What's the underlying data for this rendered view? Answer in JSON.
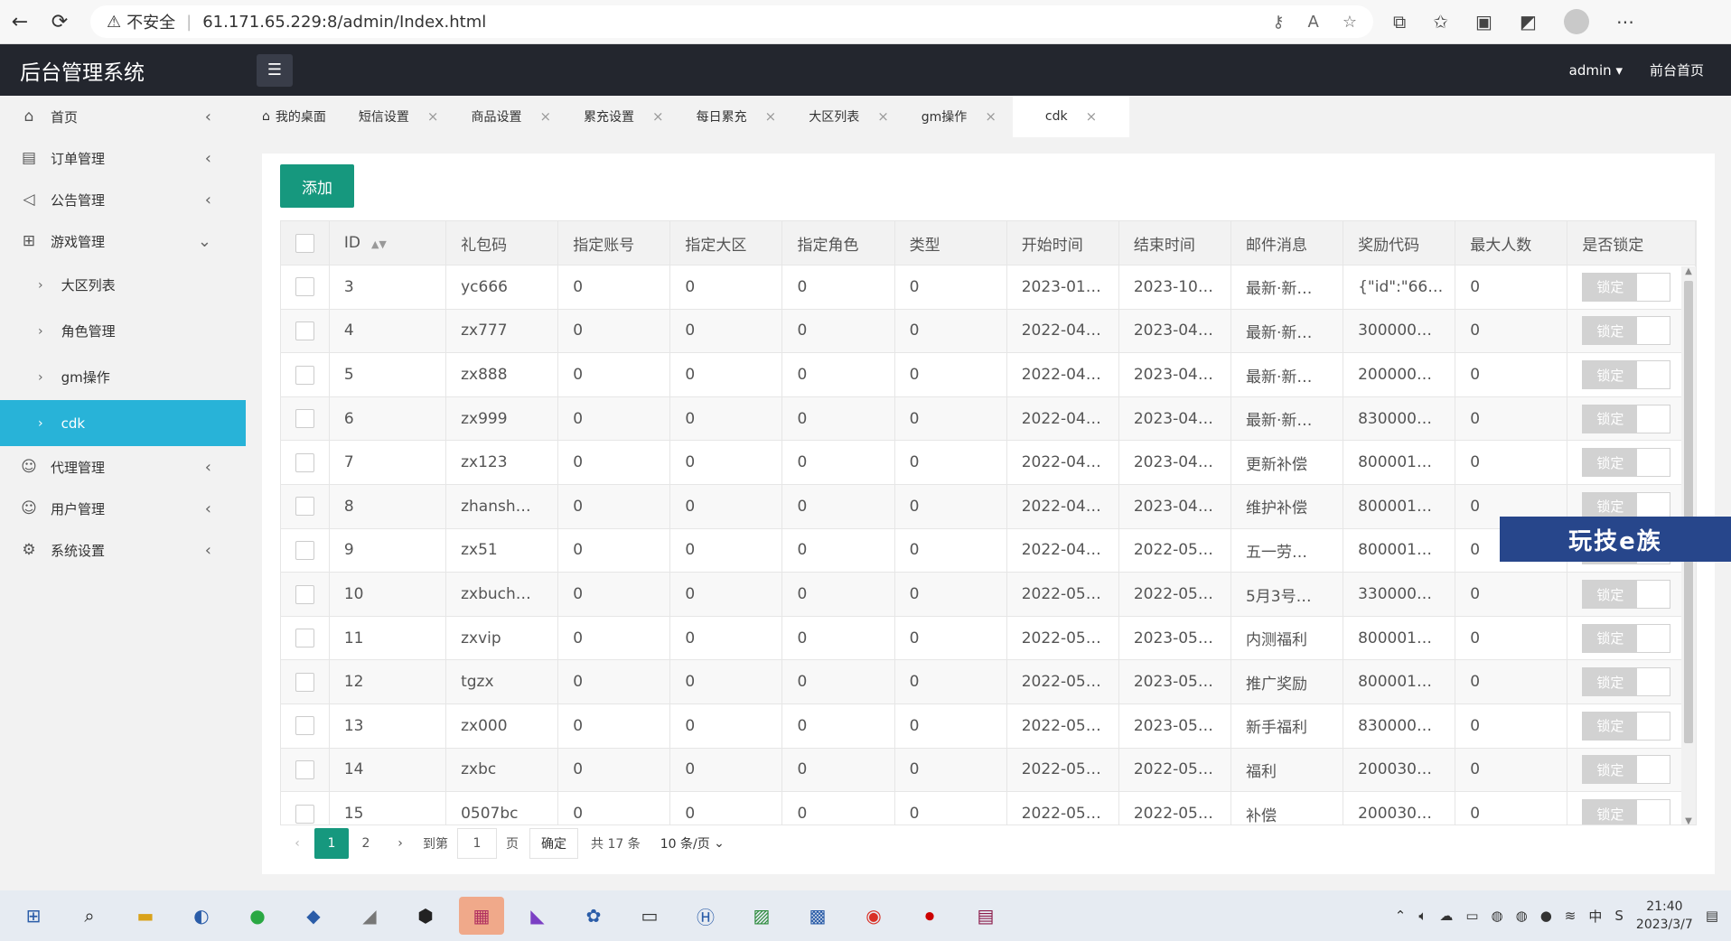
{
  "browser": {
    "security": "不安全",
    "url": "61.171.65.229:8/admin/Index.html"
  },
  "header": {
    "title": "后台管理系统",
    "user": "admin",
    "front_link": "前台首页"
  },
  "sidebar": {
    "items": [
      {
        "label": "首页",
        "icon": "home-icon"
      },
      {
        "label": "订单管理",
        "icon": "document-icon"
      },
      {
        "label": "公告管理",
        "icon": "speaker-icon"
      },
      {
        "label": "游戏管理",
        "icon": "hierarchy-icon"
      }
    ],
    "sub_items": [
      {
        "label": "大区列表"
      },
      {
        "label": "角色管理"
      },
      {
        "label": "gm操作"
      },
      {
        "label": "cdk"
      }
    ],
    "items_after": [
      {
        "label": "代理管理",
        "icon": "user-icon"
      },
      {
        "label": "用户管理",
        "icon": "user-icon"
      },
      {
        "label": "系统设置",
        "icon": "gear-icon"
      }
    ]
  },
  "tabs": [
    {
      "label": "我的桌面"
    },
    {
      "label": "短信设置"
    },
    {
      "label": "商品设置"
    },
    {
      "label": "累充设置"
    },
    {
      "label": "每日累充"
    },
    {
      "label": "大区列表"
    },
    {
      "label": "gm操作"
    },
    {
      "label": "cdk"
    }
  ],
  "toolbar": {
    "add_label": "添加"
  },
  "table": {
    "columns": [
      "ID",
      "礼包码",
      "指定账号",
      "指定大区",
      "指定角色",
      "类型",
      "开始时间",
      "结束时间",
      "邮件消息",
      "奖励代码",
      "最大人数",
      "是否锁定"
    ],
    "lock_label": "锁定",
    "rows": [
      [
        "3",
        "yc666",
        "0",
        "0",
        "0",
        "0",
        "2023-01…",
        "2023-10…",
        "最新·新…",
        "{\"id\":\"66…",
        "0"
      ],
      [
        "4",
        "zx777",
        "0",
        "0",
        "0",
        "0",
        "2022-04…",
        "2023-04…",
        "最新·新…",
        "300000…",
        "0"
      ],
      [
        "5",
        "zx888",
        "0",
        "0",
        "0",
        "0",
        "2022-04…",
        "2023-04…",
        "最新·新…",
        "200000…",
        "0"
      ],
      [
        "6",
        "zx999",
        "0",
        "0",
        "0",
        "0",
        "2022-04…",
        "2023-04…",
        "最新·新…",
        "830000…",
        "0"
      ],
      [
        "7",
        "zx123",
        "0",
        "0",
        "0",
        "0",
        "2022-04…",
        "2023-04…",
        "更新补偿",
        "800001…",
        "0"
      ],
      [
        "8",
        "zhansh…",
        "0",
        "0",
        "0",
        "0",
        "2022-04…",
        "2023-04…",
        "维护补偿",
        "800001…",
        "0"
      ],
      [
        "9",
        "zx51",
        "0",
        "0",
        "0",
        "0",
        "2022-04…",
        "2022-05…",
        "五一劳…",
        "800001…",
        "0"
      ],
      [
        "10",
        "zxbuch…",
        "0",
        "0",
        "0",
        "0",
        "2022-05…",
        "2022-05…",
        "5月3号…",
        "330000…",
        "0"
      ],
      [
        "11",
        "zxvip",
        "0",
        "0",
        "0",
        "0",
        "2022-05…",
        "2023-05…",
        "内测福利",
        "800001…",
        "0"
      ],
      [
        "12",
        "tgzx",
        "0",
        "0",
        "0",
        "0",
        "2022-05…",
        "2023-05…",
        "推广奖励",
        "800001…",
        "0"
      ],
      [
        "13",
        "zx000",
        "0",
        "0",
        "0",
        "0",
        "2022-05…",
        "2023-05…",
        "新手福利",
        "830000…",
        "0"
      ],
      [
        "14",
        "zxbc",
        "0",
        "0",
        "0",
        "0",
        "2022-05…",
        "2022-05…",
        "福利",
        "200030…",
        "0"
      ],
      [
        "15",
        "0507bc",
        "0",
        "0",
        "0",
        "0",
        "2022-05…",
        "2022-05…",
        "补偿",
        "200030…",
        "0"
      ]
    ]
  },
  "pager": {
    "pages": [
      "1",
      "2"
    ],
    "goto_label": "到第",
    "goto_value": "1",
    "page_unit": "页",
    "confirm": "确定",
    "total": "共 17 条",
    "per_page": "10 条/页"
  },
  "watermark": "玩技e族",
  "taskbar": {
    "time": "21:40",
    "date": "2023/3/7"
  },
  "colors": {
    "accent": "#16987e",
    "sidebar_active": "#28b3d8",
    "header": "#23262e"
  }
}
